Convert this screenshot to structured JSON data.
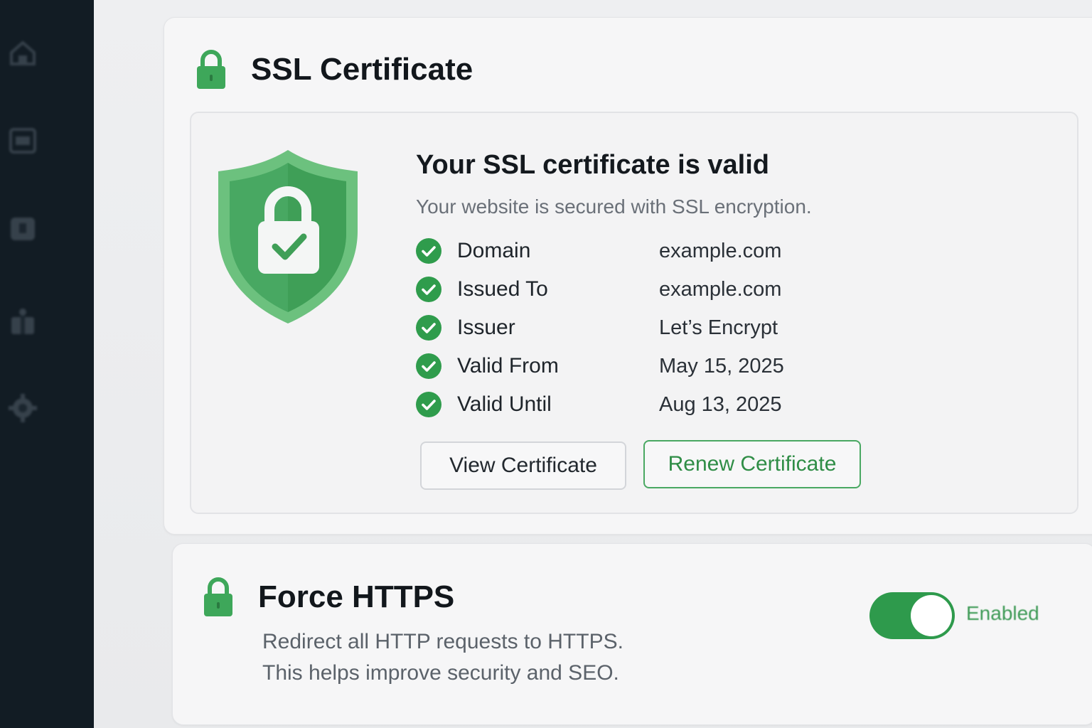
{
  "sidebar": {
    "items": [
      {
        "icon": "home-icon"
      },
      {
        "icon": "window-icon"
      },
      {
        "icon": "shield-icon"
      },
      {
        "icon": "gift-icon"
      },
      {
        "icon": "settings-icon"
      }
    ]
  },
  "ssl": {
    "title": "SSL Certificate",
    "status_title": "Your SSL certificate is valid",
    "status_subtitle": "Your website is secured with SSL encryption.",
    "details": [
      {
        "label": "Domain",
        "value": "example.com"
      },
      {
        "label": "Issued To",
        "value": "example.com"
      },
      {
        "label": "Issuer",
        "value": "Let’s Encrypt"
      },
      {
        "label": "Valid From",
        "value": "May 15, 2025"
      },
      {
        "label": "Valid Until",
        "value": "Aug 13, 2025"
      }
    ],
    "view_button": "View Certificate",
    "renew_button": "Renew Certificate"
  },
  "https": {
    "title": "Force HTTPS",
    "description_line1": "Redirect all HTTP requests to HTTPS.",
    "description_line2": "This helps improve security and SEO.",
    "toggle_state": "Enabled"
  },
  "colors": {
    "accent": "#2e9a4c",
    "sidebar": "#121c24",
    "shield_light": "#6cc17e",
    "shield_dark": "#3f9f57"
  }
}
